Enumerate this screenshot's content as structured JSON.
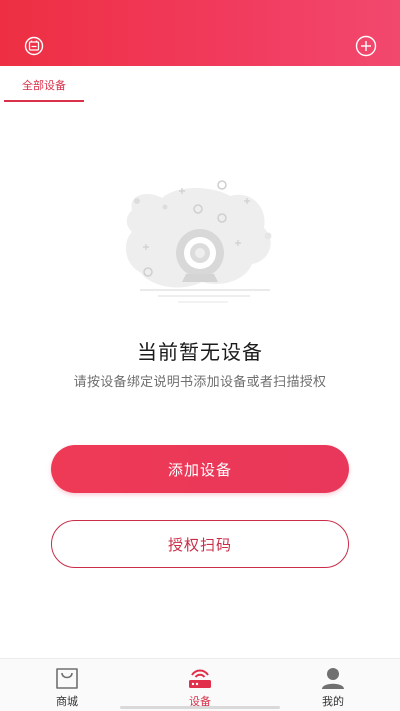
{
  "header": {
    "left_icon": "history-box-icon",
    "right_icon": "add-circle-icon",
    "gradient_start": "#ee2f42",
    "gradient_end": "#f2486e"
  },
  "tabs": [
    {
      "label": "全部设备",
      "active": true
    }
  ],
  "empty_state": {
    "illustration_icon": "camera-icon",
    "title": "当前暂无设备",
    "description": "请按设备绑定说明书添加设备或者扫描授权"
  },
  "actions": {
    "add_device_label": "添加设备",
    "scan_auth_label": "授权扫码"
  },
  "bottom_nav": [
    {
      "label": "商城",
      "icon": "shopping-bag-icon",
      "active": false
    },
    {
      "label": "设备",
      "icon": "router-icon",
      "active": true
    },
    {
      "label": "我的",
      "icon": "user-icon",
      "active": false
    }
  ],
  "colors": {
    "accent": "#d9314a",
    "primary_button": "#ef3a56"
  }
}
